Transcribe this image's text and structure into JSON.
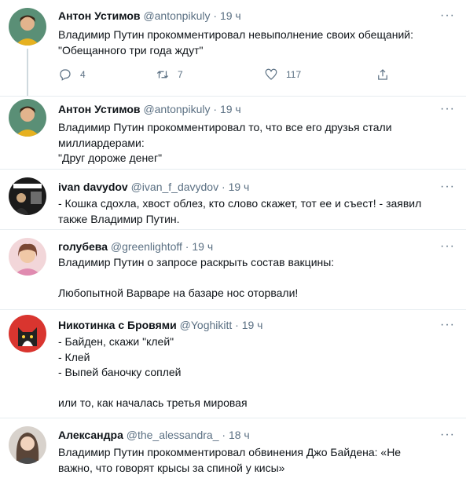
{
  "tweets": [
    {
      "name": "Антон Устимов",
      "handle": "@antonpikuly",
      "dot": "·",
      "time": "19 ч",
      "more": "···",
      "text": "Владимир Путин прокомментировал невыполнение своих обещаний:\n\"Обещанного три года ждут\"",
      "actions": {
        "replies": "4",
        "retweets": "7",
        "likes": "117"
      }
    },
    {
      "name": "Антон Устимов",
      "handle": "@antonpikuly",
      "dot": "·",
      "time": "19 ч",
      "more": "···",
      "text": "Владимир Путин прокомментировал то, что все его друзья стали\nмиллиардерами:\n\"Друг дороже денег\""
    },
    {
      "name": "ivan davydov",
      "handle": "@ivan_f_davydov",
      "dot": "·",
      "time": "19 ч",
      "more": "···",
      "text": "- Кошка сдохла, хвост облез, кто слово скажет, тот ее и съест! - заявил\nтакже Владимир Путин."
    },
    {
      "name": "голубева",
      "handle": "@greenlightoff",
      "dot": "·",
      "time": "19 ч",
      "more": "···",
      "text": "Владимир Путин о запросе раскрыть состав вакцины:\n\nЛюбопытной Варваре на базаре нос оторвали!"
    },
    {
      "name": "Никотинка с Бровями",
      "handle": "@Yoghikitt",
      "dot": "·",
      "time": "19 ч",
      "more": "···",
      "text": "- Байден, скажи \"клей\"\n- Клей\n- Выпей баночку соплей\n\nили то, как началась третья мировая"
    },
    {
      "name": "Александра",
      "handle": "@the_alessandra_",
      "dot": "·",
      "time": "18 ч",
      "more": "···",
      "text": "Владимир Путин прокомментировал обвинения Джо Байдена: «Не\nважно, что говорят крысы за спиной у кисы»"
    }
  ],
  "colors": {
    "secondary": "#5b7083",
    "divider": "#e6ecf0",
    "thread_line": "#cfd9de"
  },
  "icons": [
    "reply-icon",
    "retweet-icon",
    "like-icon",
    "share-icon",
    "more-icon"
  ]
}
